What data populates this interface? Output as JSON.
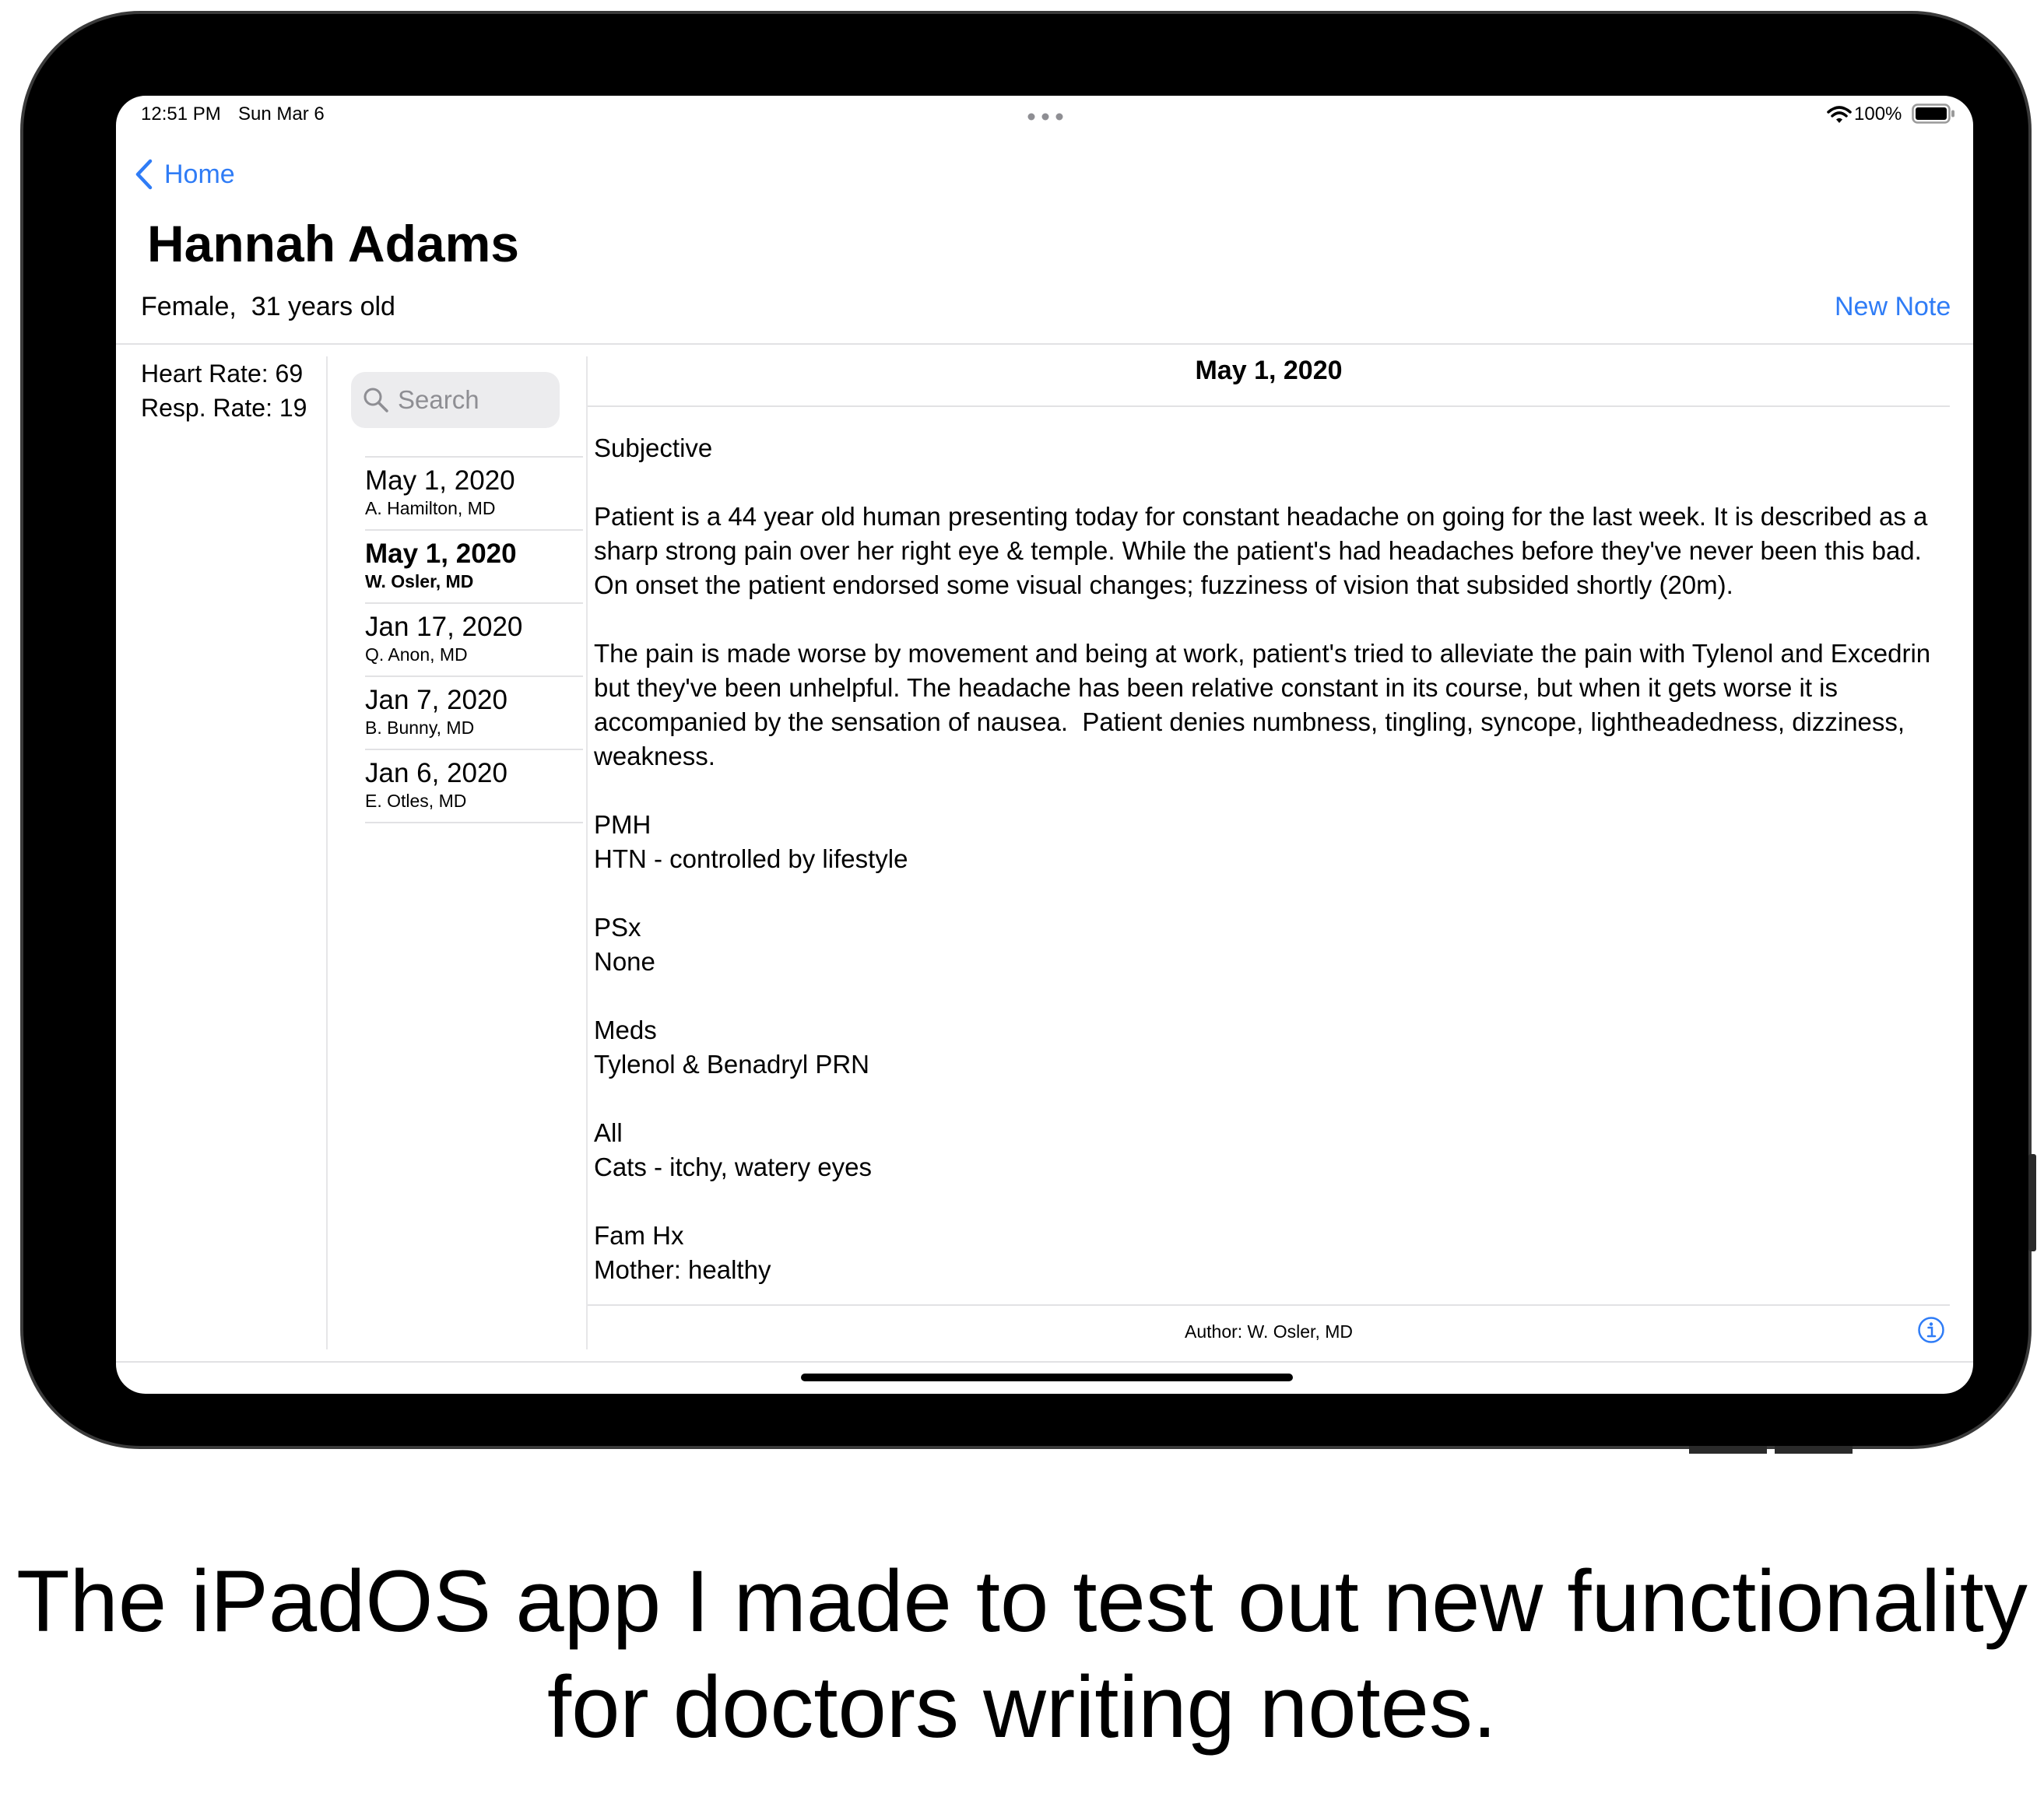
{
  "status_bar": {
    "time": "12:51 PM",
    "date": "Sun Mar 6",
    "battery": "100%"
  },
  "nav": {
    "back_label": "Home"
  },
  "patient": {
    "name": "Hannah Adams",
    "details": "Female,  31 years old"
  },
  "actions": {
    "new_note": "New Note"
  },
  "vitals": {
    "heart_rate": "Heart Rate: 69",
    "resp_rate": "Resp. Rate: 19"
  },
  "search": {
    "placeholder": "Search"
  },
  "notes_list": [
    {
      "date": "May 1, 2020",
      "author": "A. Hamilton, MD",
      "selected": false
    },
    {
      "date": "May 1, 2020",
      "author": "W. Osler, MD",
      "selected": true
    },
    {
      "date": "Jan 17, 2020",
      "author": "Q. Anon, MD",
      "selected": false
    },
    {
      "date": "Jan 7, 2020",
      "author": "B. Bunny, MD",
      "selected": false
    },
    {
      "date": "Jan 6, 2020",
      "author": "E. Otles, MD",
      "selected": false
    }
  ],
  "note": {
    "date": "May 1, 2020",
    "body": "Subjective\n\nPatient is a 44 year old human presenting today for constant headache on going for the last week. It is described as a sharp strong pain over her right eye & temple. While the patient's had headaches before they've never been this bad. On onset the patient endorsed some visual changes; fuzziness of vision that subsided shortly (20m).\n\nThe pain is made worse by movement and being at work, patient's tried to alleviate the pain with Tylenol and Excedrin but they've been unhelpful. The headache has been relative constant in its course, but when it gets worse it is accompanied by the sensation of nausea.  Patient denies numbness, tingling, syncope, lightheadedness, dizziness, weakness.\n\nPMH\nHTN - controlled by lifestyle\n\nPSx\nNone\n\nMeds\nTylenol & Benadryl PRN\n\nAll\nCats - itchy, watery eyes\n\nFam Hx\nMother: healthy",
    "author_footer": "Author: W. Osler, MD"
  },
  "caption": {
    "line1": "The iPadOS app I made to test out new functionality",
    "line2": "for doctors writing notes."
  },
  "colors": {
    "accent": "#2f7cf6",
    "bezel": "#000000",
    "separator": "#e2e2e4"
  }
}
